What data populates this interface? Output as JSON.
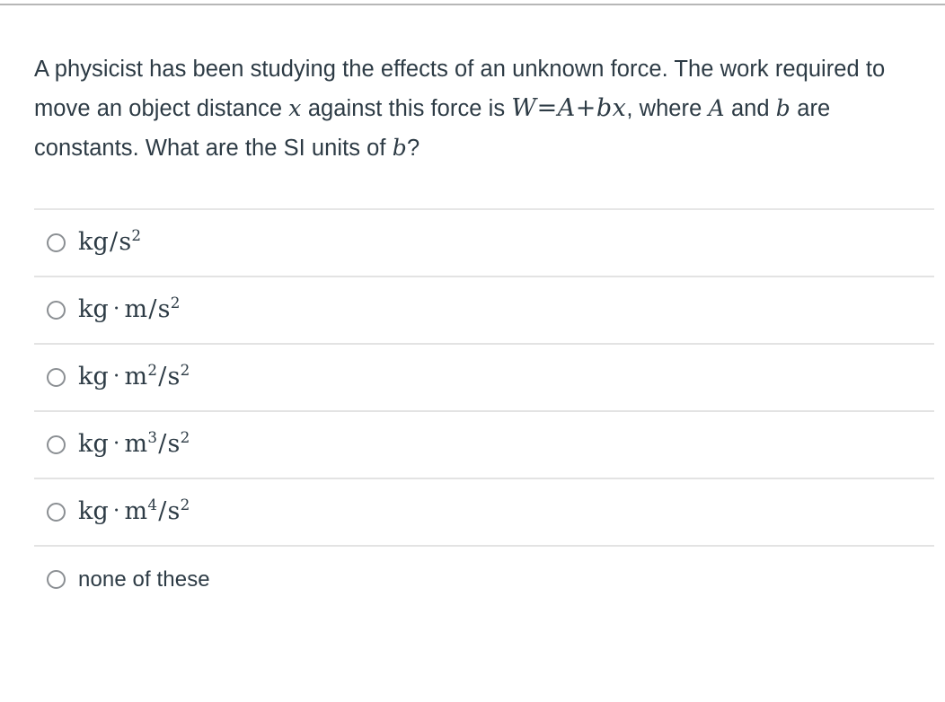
{
  "question": {
    "line1_a": "A physicist has been studying the effects of an unknown force. The",
    "line2_a": "work required to move an object distance ",
    "line2_math": "x",
    "line2_b": " against this force is",
    "equation_w": "W",
    "equation_eq": "=",
    "equation_a": "A",
    "equation_plus": "+",
    "equation_bx": "bx",
    "equation_comma": ",",
    "line3_a": " where ",
    "line3_math1": "A",
    "line3_b": " and ",
    "line3_math2": "b",
    "line3_c": " are constants. What are the SI units of",
    "line4_math": "b",
    "line4_q": "?"
  },
  "options": [
    {
      "id": "option-kg-per-s2",
      "style": "math",
      "parts": [
        {
          "t": "text",
          "v": "kg"
        },
        {
          "t": "slash",
          "v": "/"
        },
        {
          "t": "text",
          "v": "s"
        },
        {
          "t": "sup",
          "v": "2"
        }
      ],
      "plain_text": "kg/s^2"
    },
    {
      "id": "option-kg-m-per-s2",
      "style": "math",
      "parts": [
        {
          "t": "text",
          "v": "kg"
        },
        {
          "t": "dot",
          "v": "·"
        },
        {
          "t": "text",
          "v": "m"
        },
        {
          "t": "slash",
          "v": "/"
        },
        {
          "t": "text",
          "v": "s"
        },
        {
          "t": "sup",
          "v": "2"
        }
      ],
      "plain_text": "kg · m/s^2"
    },
    {
      "id": "option-kg-m2-per-s2",
      "style": "math",
      "parts": [
        {
          "t": "text",
          "v": "kg"
        },
        {
          "t": "dot",
          "v": "·"
        },
        {
          "t": "text",
          "v": "m"
        },
        {
          "t": "sup",
          "v": "2"
        },
        {
          "t": "slash",
          "v": "/"
        },
        {
          "t": "text",
          "v": "s"
        },
        {
          "t": "sup",
          "v": "2"
        }
      ],
      "plain_text": "kg · m^2/s^2"
    },
    {
      "id": "option-kg-m3-per-s2",
      "style": "math",
      "parts": [
        {
          "t": "text",
          "v": "kg"
        },
        {
          "t": "dot",
          "v": "·"
        },
        {
          "t": "text",
          "v": "m"
        },
        {
          "t": "sup",
          "v": "3"
        },
        {
          "t": "slash",
          "v": "/"
        },
        {
          "t": "text",
          "v": "s"
        },
        {
          "t": "sup",
          "v": "2"
        }
      ],
      "plain_text": "kg · m^3/s^2"
    },
    {
      "id": "option-kg-m4-per-s2",
      "style": "math",
      "parts": [
        {
          "t": "text",
          "v": "kg"
        },
        {
          "t": "dot",
          "v": "·"
        },
        {
          "t": "text",
          "v": "m"
        },
        {
          "t": "sup",
          "v": "4"
        },
        {
          "t": "slash",
          "v": "/"
        },
        {
          "t": "text",
          "v": "s"
        },
        {
          "t": "sup",
          "v": "2"
        }
      ],
      "plain_text": "kg · m^4/s^2"
    },
    {
      "id": "option-none-of-these",
      "style": "plain",
      "parts": [
        {
          "t": "text",
          "v": "none of these"
        }
      ],
      "plain_text": "none of these"
    }
  ],
  "colors": {
    "text": "#2d3b45",
    "divider": "#e3e3e3",
    "top_rule": "#b7b7b7",
    "radio_border": "#8b8f93",
    "background": "#ffffff"
  }
}
